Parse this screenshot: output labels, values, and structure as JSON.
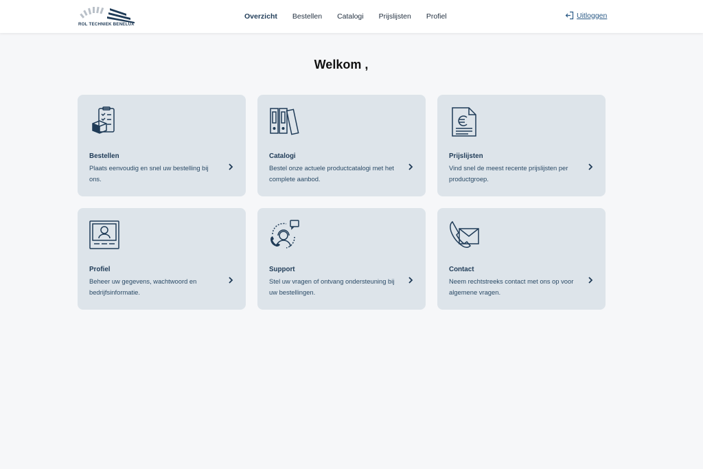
{
  "logo": {
    "text": "ROL TECHNIEK BENELUX"
  },
  "nav": [
    {
      "label": "Overzicht",
      "active": true
    },
    {
      "label": "Bestellen",
      "active": false
    },
    {
      "label": "Catalogi",
      "active": false
    },
    {
      "label": "Prijslijsten",
      "active": false
    },
    {
      "label": "Profiel",
      "active": false
    }
  ],
  "logout": {
    "label": "Uitloggen",
    "icon": "logout-icon"
  },
  "welcome": "Welkom ,",
  "cards": [
    {
      "title": "Bestellen",
      "desc": "Plaats eenvoudig en snel uw bestelling bij ons.",
      "icon": "order-clipboard-icon"
    },
    {
      "title": "Catalogi",
      "desc": "Bestel onze actuele productcatalogi met het complete aanbod.",
      "icon": "binders-icon"
    },
    {
      "title": "Prijslijsten",
      "desc": "Vind snel de meest recente prijslijsten per productgroep.",
      "icon": "euro-document-icon"
    },
    {
      "title": "Profiel",
      "desc": "Beheer uw gegevens, wachtwoord en bedrijfsinformatie.",
      "icon": "profile-card-icon"
    },
    {
      "title": "Support",
      "desc": "Stel uw vragen of ontvang ondersteuning bij uw bestellingen.",
      "icon": "support-agent-icon"
    },
    {
      "title": "Contact",
      "desc": "Neem rechtstreeks contact met ons op voor algemene vragen.",
      "icon": "phone-mail-icon"
    }
  ],
  "colors": {
    "accent": "#1f3b57",
    "card_bg": "#dde4ea",
    "page_bg": "#f6f7f9",
    "link": "#2a5a86"
  }
}
